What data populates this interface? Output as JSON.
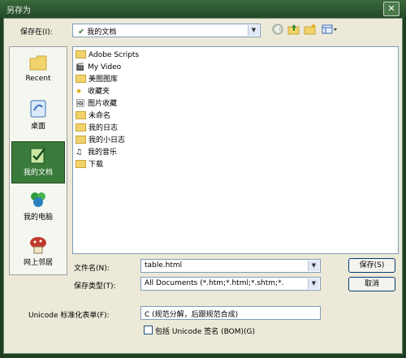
{
  "window": {
    "title": "另存为",
    "close_glyph": "✕"
  },
  "toolbar": {
    "save_in_label": "保存在(I):",
    "save_in_hotkey": "I",
    "save_in_value": "我的文档",
    "icons": [
      "back-icon",
      "up-folder-icon",
      "new-folder-icon",
      "views-menu-icon"
    ]
  },
  "places": [
    {
      "label": "Recent",
      "icon": "recent-icon"
    },
    {
      "label": "桌面",
      "icon": "desktop-icon"
    },
    {
      "label": "我的文档",
      "icon": "my-documents-icon",
      "selected": true
    },
    {
      "label": "我的电脑",
      "icon": "my-computer-icon"
    },
    {
      "label": "网上邻居",
      "icon": "network-icon"
    }
  ],
  "files": [
    {
      "name": "Adobe Scripts",
      "icon": "folder-icon"
    },
    {
      "name": "My Video",
      "icon": "video-folder-icon"
    },
    {
      "name": "美图图库",
      "icon": "folder-icon"
    },
    {
      "name": "收藏夹",
      "icon": "favorites-icon"
    },
    {
      "name": "图片收藏",
      "icon": "pictures-folder-icon"
    },
    {
      "name": "未命名",
      "icon": "folder-icon"
    },
    {
      "name": "我的日志",
      "icon": "folder-icon"
    },
    {
      "name": "我的小日志",
      "icon": "folder-icon"
    },
    {
      "name": "我的音乐",
      "icon": "music-folder-icon"
    },
    {
      "name": "下载",
      "icon": "folder-icon"
    }
  ],
  "filename": {
    "label": "文件名(N):",
    "value": "table.html"
  },
  "filetype": {
    "label": "保存类型(T):",
    "value": "All Documents (*.htm;*.html;*.shtm;*."
  },
  "buttons": {
    "save": "保存(S)",
    "cancel": "取消"
  },
  "unicode": {
    "label": "Unicode 标准化表单(F):",
    "value": "C (规范分解，后跟规范合成)",
    "signature_label": "包括 Unicode 签名 (BOM)(G)",
    "signature_checked": false
  },
  "colors": {
    "accent": "#3a7a3a",
    "chrome": "#24482a",
    "dialog_bg": "#ece9d8"
  }
}
